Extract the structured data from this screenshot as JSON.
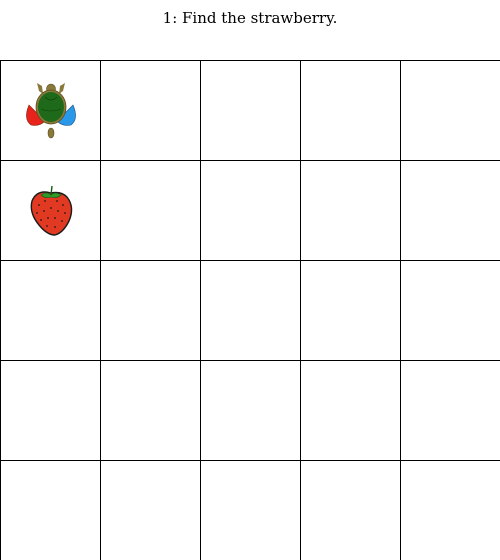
{
  "prompt": {
    "text": "1: Find the strawberry."
  },
  "grid": {
    "rows": 5,
    "cols": 5,
    "items": [
      {
        "row": 0,
        "col": 0,
        "icon": "turtle-icon"
      },
      {
        "row": 1,
        "col": 0,
        "icon": "strawberry-icon"
      }
    ]
  }
}
